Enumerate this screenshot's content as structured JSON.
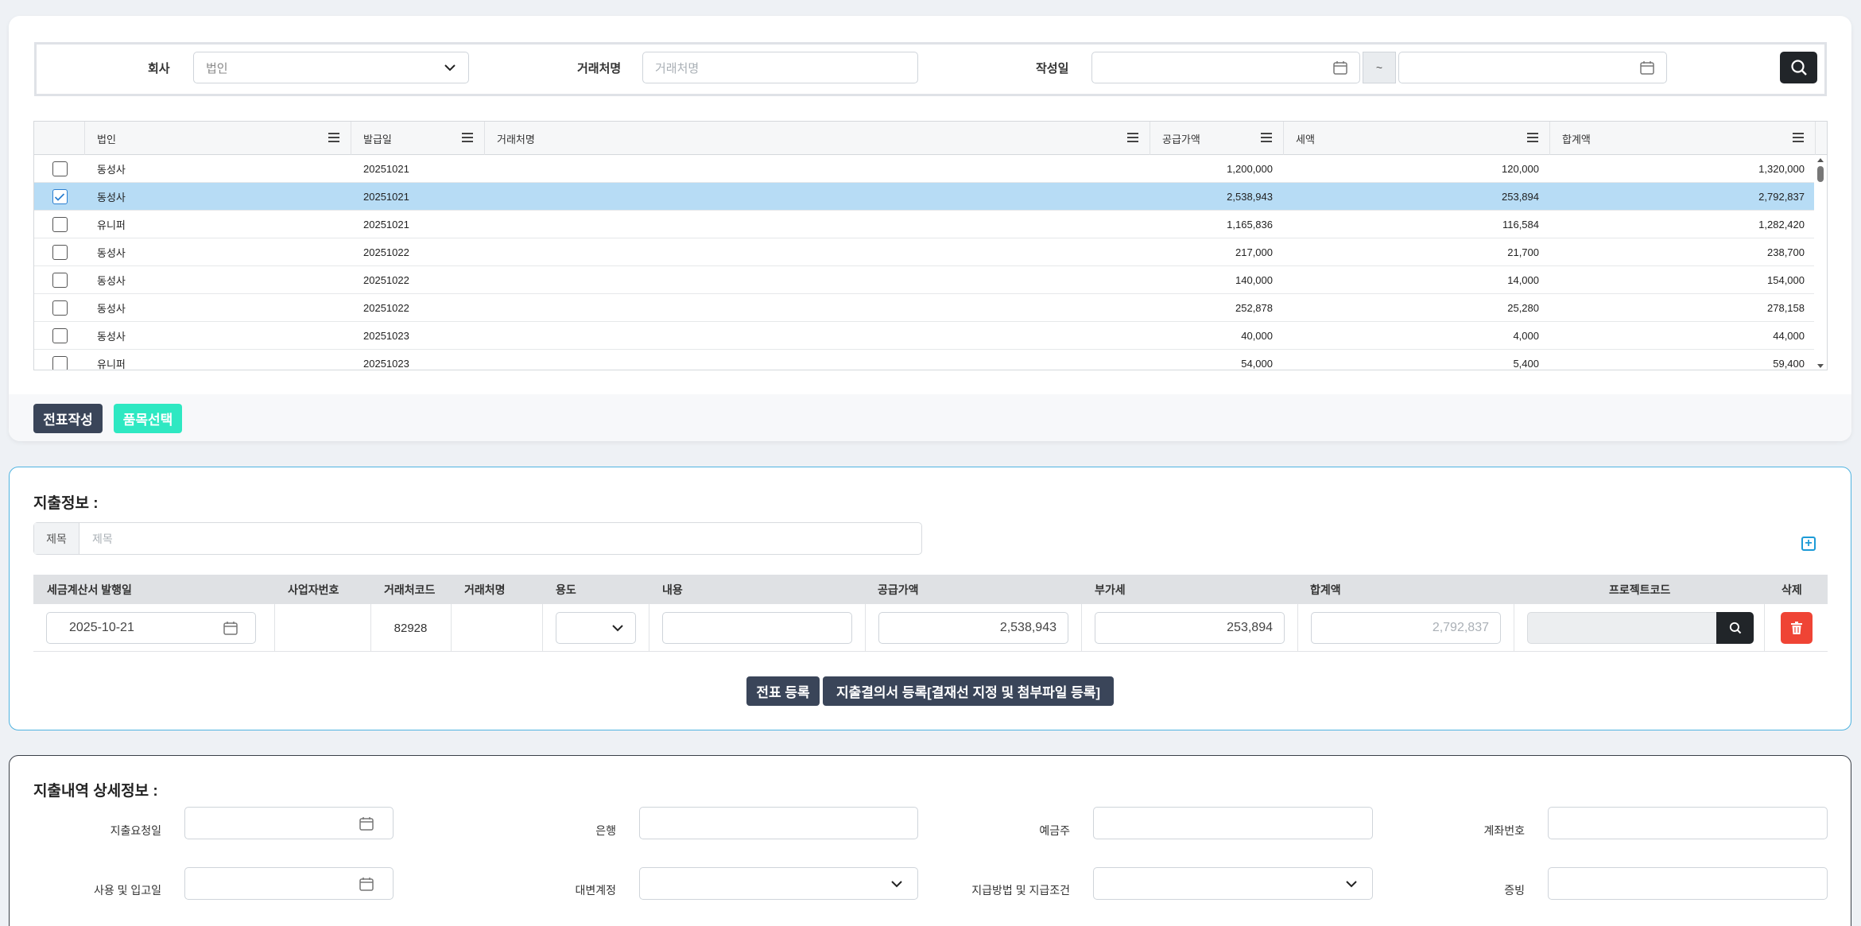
{
  "search": {
    "company_label": "회사",
    "company_value": "법인",
    "vendor_label": "거래처명",
    "vendor_placeholder": "거래처명",
    "date_label": "작성일",
    "date_from": "",
    "date_to": "",
    "tilde": "~"
  },
  "grid": {
    "columns": [
      "법인",
      "발급일",
      "거래처명",
      "공급가액",
      "세액",
      "합계액"
    ],
    "rows": [
      {
        "corp": "동성사",
        "date": "20251021",
        "vendor": "",
        "supply": "1,200,000",
        "tax": "120,000",
        "total": "1,320,000",
        "checked": false
      },
      {
        "corp": "동성사",
        "date": "20251021",
        "vendor": "",
        "supply": "2,538,943",
        "tax": "253,894",
        "total": "2,792,837",
        "checked": true
      },
      {
        "corp": "유니퍼",
        "date": "20251021",
        "vendor": "",
        "supply": "1,165,836",
        "tax": "116,584",
        "total": "1,282,420",
        "checked": false
      },
      {
        "corp": "동성사",
        "date": "20251022",
        "vendor": "",
        "supply": "217,000",
        "tax": "21,700",
        "total": "238,700",
        "checked": false
      },
      {
        "corp": "동성사",
        "date": "20251022",
        "vendor": "",
        "supply": "140,000",
        "tax": "14,000",
        "total": "154,000",
        "checked": false
      },
      {
        "corp": "동성사",
        "date": "20251022",
        "vendor": "",
        "supply": "252,878",
        "tax": "25,280",
        "total": "278,158",
        "checked": false
      },
      {
        "corp": "동성사",
        "date": "20251023",
        "vendor": "",
        "supply": "40,000",
        "tax": "4,000",
        "total": "44,000",
        "checked": false
      },
      {
        "corp": "유니퍼",
        "date": "20251023",
        "vendor": "",
        "supply": "54,000",
        "tax": "5,400",
        "total": "59,400",
        "checked": false
      }
    ]
  },
  "actions": {
    "write_voucher": "전표작성",
    "select_item": "품목선택"
  },
  "expense": {
    "title": "지출정보 :",
    "subject_prefix": "제목",
    "subject_placeholder": "제목",
    "columns": [
      "세금계산서 발행일",
      "사업자번호",
      "거래처코드",
      "거래처명",
      "용도",
      "내용",
      "공급가액",
      "부가세",
      "합계액",
      "프로젝트코드",
      "삭제"
    ],
    "row": {
      "issue_date": "2025-10-21",
      "biz_no": "",
      "vendor_code": "82928",
      "vendor_name": "",
      "purpose": "",
      "content": "",
      "supply": "2,538,943",
      "vat": "253,894",
      "total": "2,792,837",
      "project_code": ""
    },
    "register_voucher": "전표 등록",
    "register_resolution": "지출결의서 등록[결재선 지정 및 첨부파일 등록]"
  },
  "detail": {
    "title": "지출내역 상세정보 :",
    "labels": {
      "request_date": "지출요청일",
      "bank": "은행",
      "depositor": "예금주",
      "account": "계좌번호",
      "use_date": "사용 및 입고일",
      "counter_account": "대변계정",
      "payment_method": "지급방법 및 지급조건",
      "evidence": "증빙"
    }
  },
  "colors": {
    "dark_button": "#3a4559",
    "teal_button": "#2ee8c2",
    "selected_row": "#b7dcf5",
    "delete_button": "#ef4435",
    "panel2_border": "#4fb3e0"
  }
}
